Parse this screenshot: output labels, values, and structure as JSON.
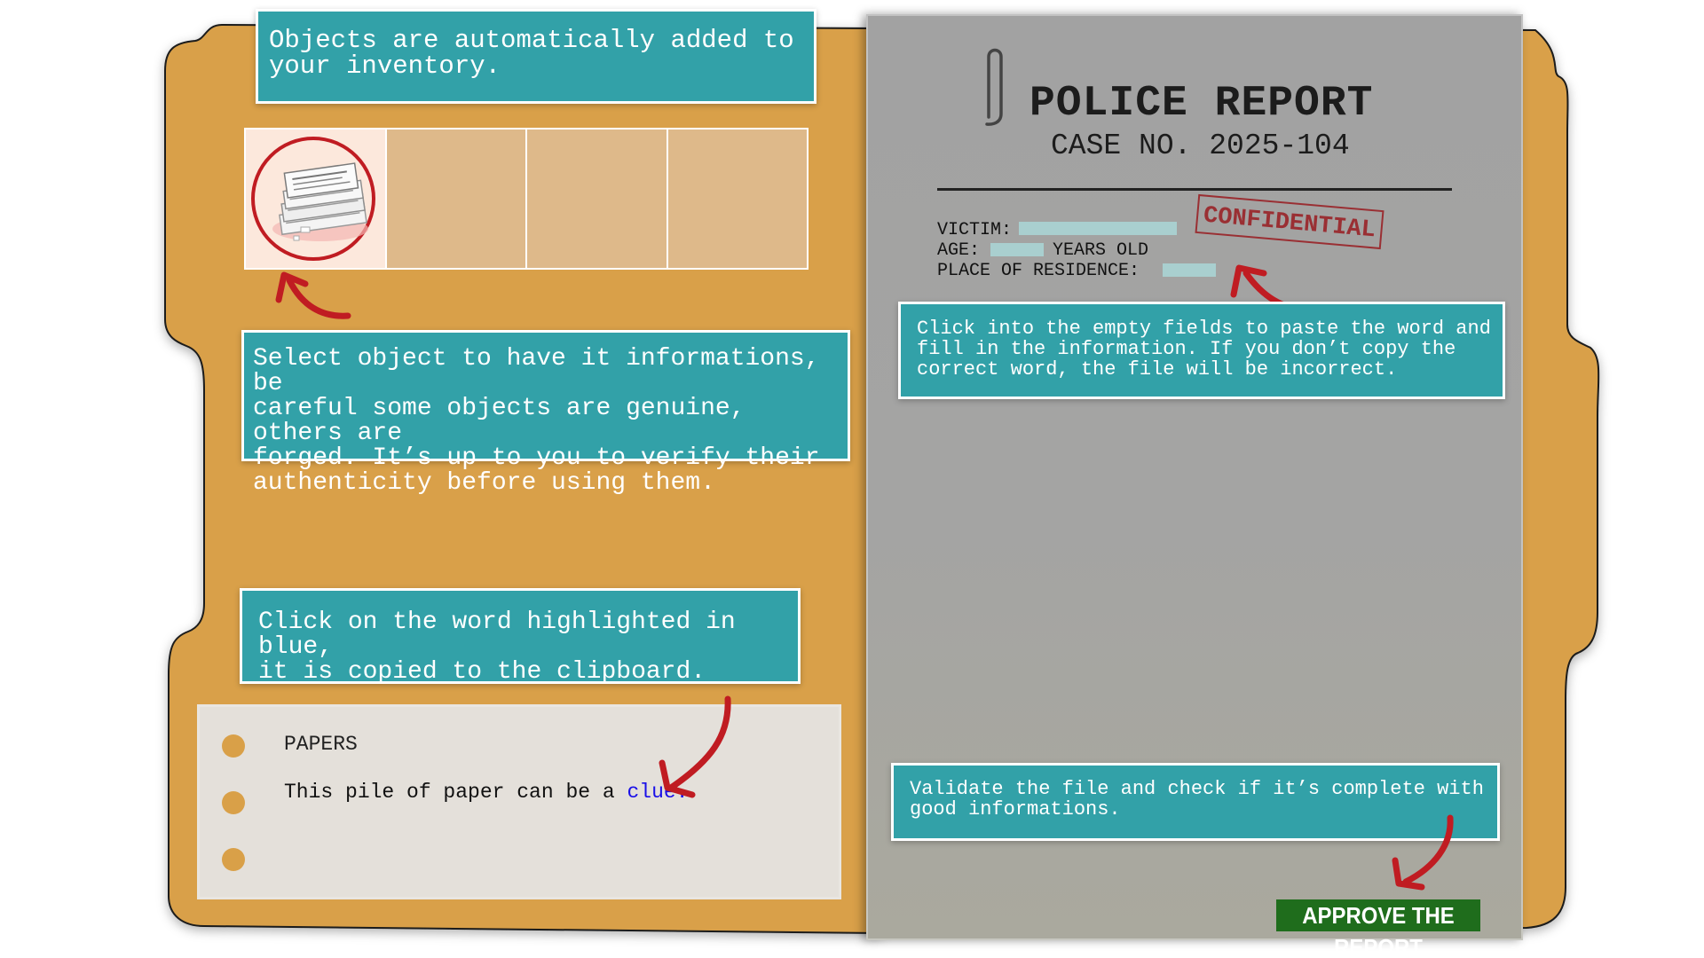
{
  "tooltips": {
    "inventory": "Objects are automatically added to\nyour inventory.",
    "select": "Select object to have it informations, be\ncareful some objects are genuine, others are\nforged. It’s up to you to verify their\nauthenticity before using them.",
    "clipboard": "Click on the word highlighted in blue,\nit is copied to the clipboard.",
    "fields": "Click into the empty fields to paste the word and\nfill in the information. If you don’t copy the\ncorrect word, the file will be incorrect.",
    "validate": "Validate the file and check if it’s complete with\ngood informations."
  },
  "inventory": {
    "slots": [
      {
        "item": "papers-pile-icon",
        "selected": true
      },
      {
        "item": null,
        "selected": false
      },
      {
        "item": null,
        "selected": false
      },
      {
        "item": null,
        "selected": false
      }
    ]
  },
  "notes": {
    "title": "PAPERS",
    "text_prefix": "This pile of paper can be a",
    "clue_word": "clue."
  },
  "report": {
    "title": "POLICE REPORT",
    "case_number": "CASE NO. 2025-104",
    "victim_label": "VICTIM:",
    "age_label": "AGE:",
    "age_suffix": "YEARS OLD",
    "residence_label": "PLACE OF RESIDENCE:",
    "stamp": "CONFIDENTIAL",
    "approve_label": "APPROVE THE REPORT"
  },
  "colors": {
    "folder": "#d9a048",
    "tooltip": "#32a1a8",
    "report_paper": "#a4a4a3",
    "clue_highlight": "#1a10e8",
    "arrow": "#c01c22",
    "approve": "#1f6d1c",
    "stamp": "#9a2f33"
  }
}
